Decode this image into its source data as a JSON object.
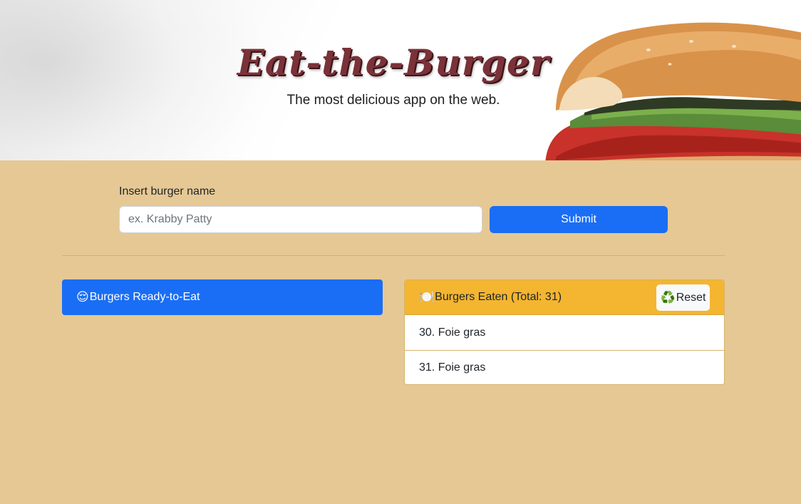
{
  "hero": {
    "title": "Eat-the-Burger",
    "subtitle": "The most delicious app on the web."
  },
  "form": {
    "label": "Insert burger name",
    "input_value": "",
    "input_placeholder": "ex. Krabby Patty",
    "submit_label": "Submit"
  },
  "ready": {
    "emoji": "😌",
    "title": "Burgers Ready-to-Eat",
    "items": []
  },
  "eaten": {
    "emoji": "🍽️",
    "title": "Burgers Eaten (Total: 31)",
    "reset_emoji": "♻️",
    "reset_label": "Reset",
    "items": [
      {
        "label": "30. Foie gras"
      },
      {
        "label": "31. Foie gras"
      }
    ]
  },
  "colors": {
    "background": "#e6c894",
    "primary": "#1a6ef5",
    "warning": "#f4b530",
    "title": "#7a3238"
  }
}
